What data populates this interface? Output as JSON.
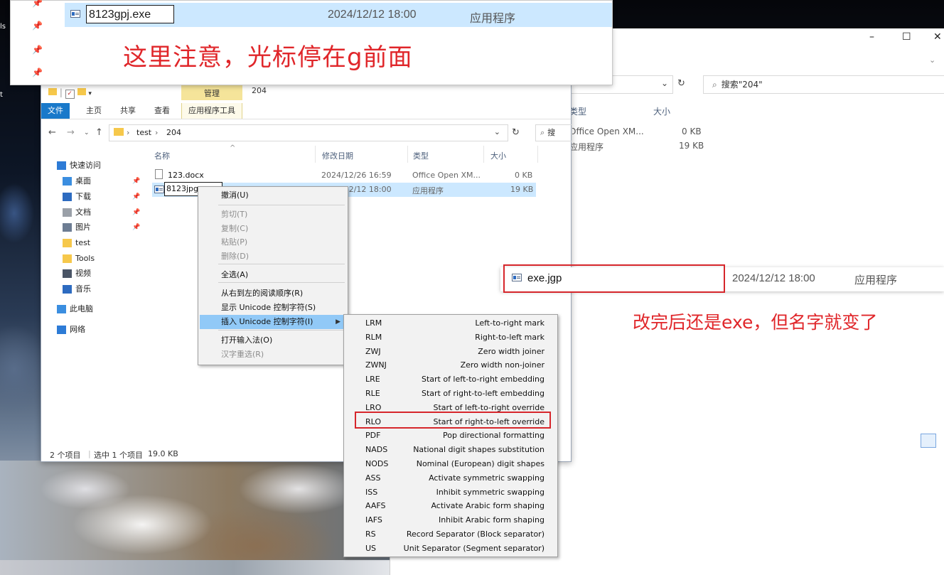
{
  "desktop": {
    "labels": [
      "ls",
      "t"
    ]
  },
  "top_panel": {
    "row": {
      "name_value": "8123gpj.exe",
      "date": "2024/12/12 18:00",
      "type": "应用程序"
    },
    "note": "这里注意，光标停在g前面"
  },
  "right_window": {
    "controls": {
      "minimize": "–",
      "maximize": "☐",
      "close": "✕"
    },
    "search_placeholder": "搜索\"204\"",
    "columns": {
      "type": "类型",
      "size": "大小"
    },
    "rows": [
      {
        "type": "Office Open XM...",
        "size": "0 KB"
      },
      {
        "type": "应用程序",
        "size": "19 KB"
      }
    ],
    "result": {
      "name": "exe.jgp",
      "date": "2024/12/12 18:00",
      "type": "应用程序"
    },
    "note": "改完后还是exe，但名字就变了"
  },
  "main_window": {
    "manage_tab": "管理",
    "title_path": "204",
    "ribbon_tabs": [
      "文件",
      "主页",
      "共享",
      "查看",
      "应用程序工具"
    ],
    "breadcrumb": [
      "test",
      "204"
    ],
    "search_stub": "搜",
    "nav_items": [
      {
        "label": "快速访问",
        "icon": "star-icon",
        "color": "#2d7bd6",
        "pinned": false
      },
      {
        "label": "桌面",
        "icon": "desktop-icon",
        "color": "#3b8ee0",
        "pinned": true
      },
      {
        "label": "下载",
        "icon": "download-icon",
        "color": "#2d6bc0",
        "pinned": true
      },
      {
        "label": "文档",
        "icon": "document-icon",
        "color": "#9aa0a8",
        "pinned": true
      },
      {
        "label": "图片",
        "icon": "picture-icon",
        "color": "#6d7d93",
        "pinned": true
      },
      {
        "label": "test",
        "icon": "folder-icon",
        "color": "#f6c84b",
        "pinned": false
      },
      {
        "label": "Tools",
        "icon": "folder-icon",
        "color": "#f6c84b",
        "pinned": false
      },
      {
        "label": "视频",
        "icon": "video-icon",
        "color": "#4a5566",
        "pinned": false
      },
      {
        "label": "音乐",
        "icon": "music-icon",
        "color": "#2d6bc0",
        "pinned": false
      },
      {
        "label": "此电脑",
        "icon": "computer-icon",
        "color": "#3b8ee0",
        "pinned": false
      },
      {
        "label": "网络",
        "icon": "network-icon",
        "color": "#2d7bd6",
        "pinned": false
      }
    ],
    "columns": {
      "name": "名称",
      "modified": "修改日期",
      "type": "类型",
      "size": "大小"
    },
    "files": [
      {
        "name": "123.docx",
        "modified": "2024/12/26 16:59",
        "type": "Office Open XM...",
        "size": "0 KB",
        "icon": "doc-icon"
      },
      {
        "name": "8123jpg",
        "modified": "2024/12/12 18:00",
        "type": "应用程序",
        "size": "19 KB",
        "icon": "exe-icon"
      }
    ],
    "status": {
      "count": "2 个项目",
      "selected": "选中 1 个项目",
      "size": "19.0 KB"
    }
  },
  "context_menu": {
    "items": [
      {
        "label": "撤消(U)",
        "disabled": false
      },
      {
        "label": "剪切(T)",
        "disabled": true
      },
      {
        "label": "复制(C)",
        "disabled": true
      },
      {
        "label": "粘贴(P)",
        "disabled": true
      },
      {
        "label": "删除(D)",
        "disabled": true
      },
      {
        "label": "全选(A)",
        "disabled": false
      },
      {
        "label": "从右到左的阅读顺序(R)",
        "disabled": false
      },
      {
        "label": "显示 Unicode 控制字符(S)",
        "disabled": false
      },
      {
        "label": "插入 Unicode 控制字符(I)",
        "disabled": false,
        "highlighted": true,
        "submenu": true
      },
      {
        "label": "打开输入法(O)",
        "disabled": false
      },
      {
        "label": "汉字重选(R)",
        "disabled": true
      }
    ]
  },
  "unicode_submenu": {
    "items": [
      {
        "code": "LRM",
        "desc": "Left-to-right mark"
      },
      {
        "code": "RLM",
        "desc": "Right-to-left mark"
      },
      {
        "code": "ZWJ",
        "desc": "Zero width joiner"
      },
      {
        "code": "ZWNJ",
        "desc": "Zero width non-joiner"
      },
      {
        "code": "LRE",
        "desc": "Start of left-to-right embedding"
      },
      {
        "code": "RLE",
        "desc": "Start of right-to-left embedding"
      },
      {
        "code": "LRO",
        "desc": "Start of left-to-right override"
      },
      {
        "code": "RLO",
        "desc": "Start of right-to-left override",
        "boxed": true
      },
      {
        "code": "PDF",
        "desc": "Pop directional formatting"
      },
      {
        "code": "NADS",
        "desc": "National digit shapes substitution"
      },
      {
        "code": "NODS",
        "desc": "Nominal (European) digit shapes"
      },
      {
        "code": "ASS",
        "desc": "Activate symmetric swapping"
      },
      {
        "code": "ISS",
        "desc": "Inhibit symmetric swapping"
      },
      {
        "code": "AAFS",
        "desc": "Activate Arabic form shaping"
      },
      {
        "code": "IAFS",
        "desc": "Inhibit Arabic form shaping"
      },
      {
        "code": "RS",
        "desc": "Record Separator (Block separator)"
      },
      {
        "code": "US",
        "desc": "Unit Separator (Segment separator)"
      }
    ]
  },
  "colors": {
    "annotation_red": "#e0262a",
    "selection_blue": "#cce8ff",
    "file_tab_blue": "#1979ca",
    "manage_tab_yellow": "#f5e49a"
  }
}
